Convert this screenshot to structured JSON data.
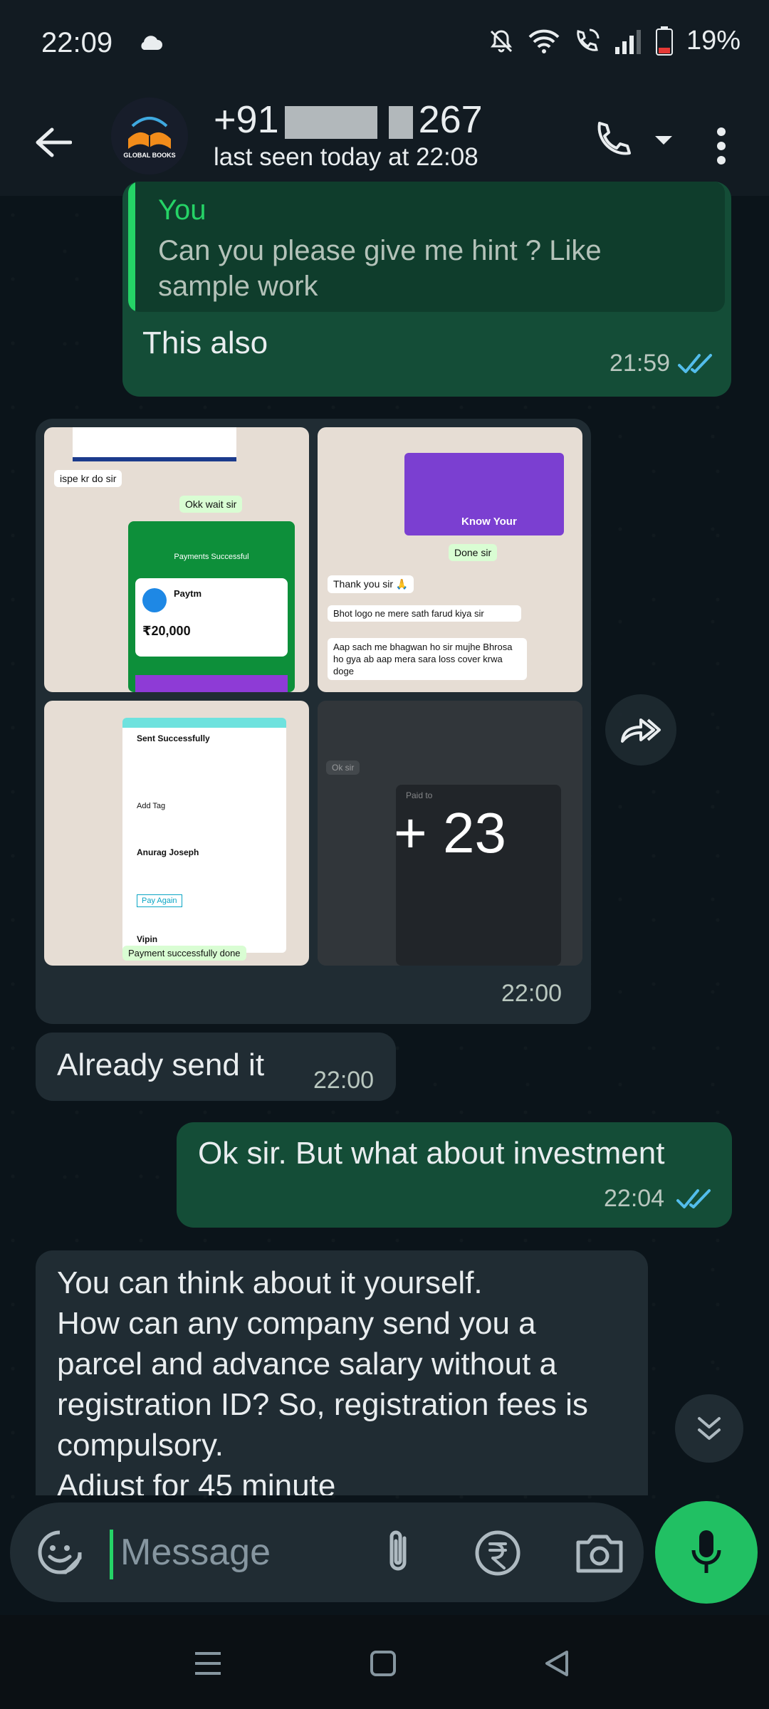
{
  "status_bar": {
    "time": "22:09",
    "battery": "19%"
  },
  "header": {
    "contact_name_prefix": "+91",
    "contact_name_suffix": "267",
    "last_seen": "last seen today at 22:08",
    "avatar_text": "GLOBAL BOOKS"
  },
  "messages": {
    "m1": {
      "quote_author": "You",
      "quote_text": "Can you please give me hint ? Like sample work",
      "text": "This also",
      "time": "21:59"
    },
    "media": {
      "more_count": "+ 23",
      "time": "22:00",
      "thumb1": {
        "line1": "ispe kr do sir",
        "line2": "Okk wait sir",
        "line3": "Payments Successful",
        "line4": "Paytm",
        "amount": "₹20,000"
      },
      "thumb2": {
        "line1": "Know Your",
        "line2": "Done sir",
        "line3": "Thank you sir 🙏",
        "line4": "Bhot logo ne mere sath farud kiya sir",
        "line5": "Aap sach me bhagwan ho sir mujhe Bhrosa ho gya ab aap mera sara loss cover krwa doge"
      },
      "thumb3": {
        "line1": "Sent Successfully",
        "line2": "Add Tag",
        "line3": "Anurag Joseph",
        "line4": "Pay Again",
        "line5": "Vipin",
        "line6": "Payment successfully done"
      },
      "thumb4": {
        "line1": "Ok sir",
        "line2": "Paid to"
      }
    },
    "m2": {
      "text": "Already send it",
      "time": "22:00"
    },
    "m3": {
      "text": "Ok sir. But what about investment",
      "time": "22:04"
    },
    "m4": {
      "text_lines": [
        "You can think about it yourself.",
        "How can any company send you a",
        "parcel and advance salary without a",
        "registration ID? So, registration fees is",
        "compulsory.",
        "Adjust for 45 minute"
      ]
    }
  },
  "composer": {
    "placeholder": "Message"
  },
  "colors": {
    "accent": "#25d366",
    "outgoing_bubble": "#144d37",
    "incoming_bubble": "#202c33",
    "tick_read": "#53bdeb"
  }
}
